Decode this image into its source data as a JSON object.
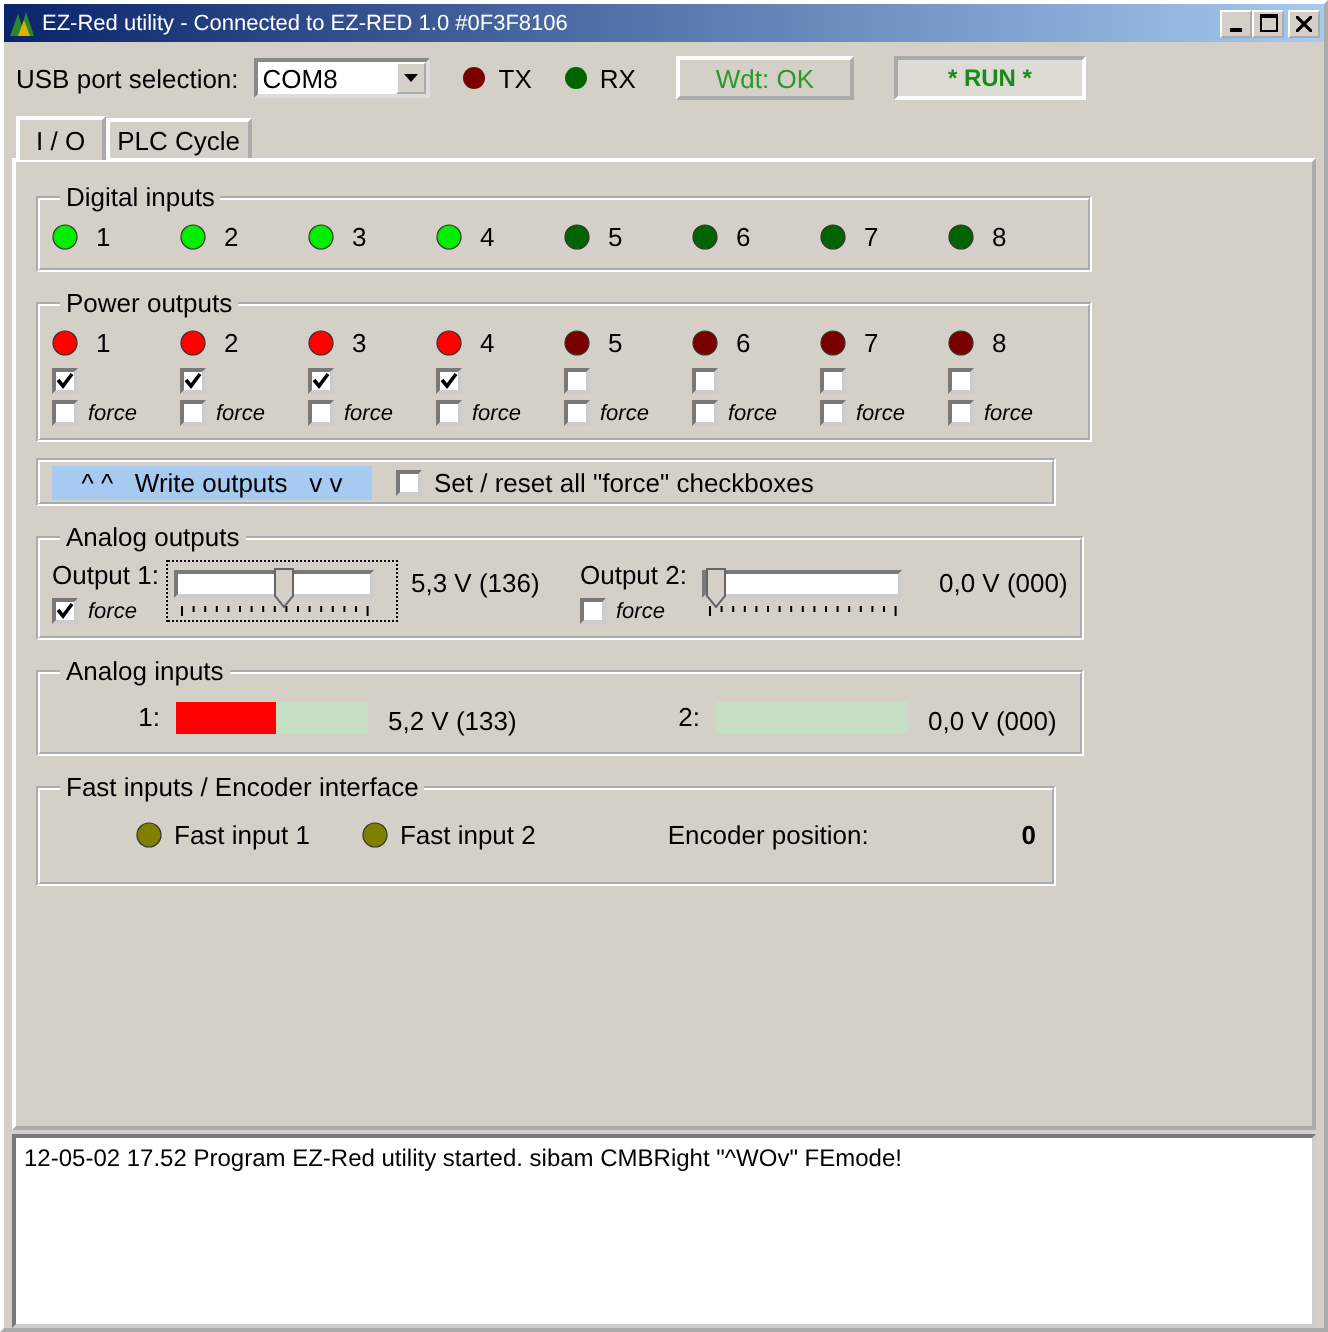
{
  "window": {
    "title": "EZ-Red utility - Connected to EZ-RED 1.0  #0F3F8106"
  },
  "toolbar": {
    "port_label": "USB port selection:",
    "port_value": "COM8",
    "indicators": [
      {
        "label": "TX",
        "on": false,
        "kind": "red"
      },
      {
        "label": "RX",
        "on": false,
        "kind": "green"
      }
    ],
    "wdt_button": "Wdt: OK",
    "run_button": "* RUN *"
  },
  "tabs": [
    {
      "label": "I / O",
      "selected": true
    },
    {
      "label": "PLC Cycle",
      "selected": false
    }
  ],
  "digital_inputs": {
    "title": "Digital inputs",
    "items": [
      {
        "label": "1",
        "on": true
      },
      {
        "label": "2",
        "on": true
      },
      {
        "label": "3",
        "on": true
      },
      {
        "label": "4",
        "on": true
      },
      {
        "label": "5",
        "on": false
      },
      {
        "label": "6",
        "on": false
      },
      {
        "label": "7",
        "on": false
      },
      {
        "label": "8",
        "on": false
      }
    ]
  },
  "power_outputs": {
    "title": "Power outputs",
    "items": [
      {
        "label": "1",
        "on": true,
        "checked": true,
        "force": false,
        "force_label": "force"
      },
      {
        "label": "2",
        "on": true,
        "checked": true,
        "force": false,
        "force_label": "force"
      },
      {
        "label": "3",
        "on": true,
        "checked": true,
        "force": false,
        "force_label": "force"
      },
      {
        "label": "4",
        "on": true,
        "checked": true,
        "force": false,
        "force_label": "force"
      },
      {
        "label": "5",
        "on": false,
        "checked": false,
        "force": false,
        "force_label": "force"
      },
      {
        "label": "6",
        "on": false,
        "checked": false,
        "force": false,
        "force_label": "force"
      },
      {
        "label": "7",
        "on": false,
        "checked": false,
        "force": false,
        "force_label": "force"
      },
      {
        "label": "8",
        "on": false,
        "checked": false,
        "force": false,
        "force_label": "force"
      }
    ]
  },
  "write_bar": {
    "button": "^ ^   Write outputs   v v",
    "checkbox_label": "Set / reset all \"force\" checkboxes",
    "checked": false
  },
  "analog_outputs": {
    "title": "Analog outputs",
    "items": [
      {
        "label": "Output 1:",
        "level": 0.533,
        "reading": "5,3 V (136)",
        "force_label": "force",
        "force": true,
        "focused": true
      },
      {
        "label": "Output 2:",
        "level": 0,
        "reading": "0,0 V (000)",
        "force_label": "force",
        "force": false,
        "focused": false
      }
    ]
  },
  "analog_inputs": {
    "title": "Analog inputs",
    "items": [
      {
        "label": "1:",
        "level": 0.52,
        "reading": "5,2 V (133)"
      },
      {
        "label": "2:",
        "reading": "0,0 V (000)"
      }
    ]
  },
  "fast_inputs": {
    "title": "Fast inputs / Encoder interface",
    "items": [
      {
        "label": "Fast input 1",
        "on": false
      },
      {
        "label": "Fast input 2",
        "on": false
      }
    ],
    "encoder_label": "Encoder position:",
    "encoder_value": "0"
  },
  "log": {
    "lines": [
      "12-05-02 17.52  Program EZ-Red utility started. sibam CMBRight \"^WOv\" FEmode!"
    ]
  }
}
